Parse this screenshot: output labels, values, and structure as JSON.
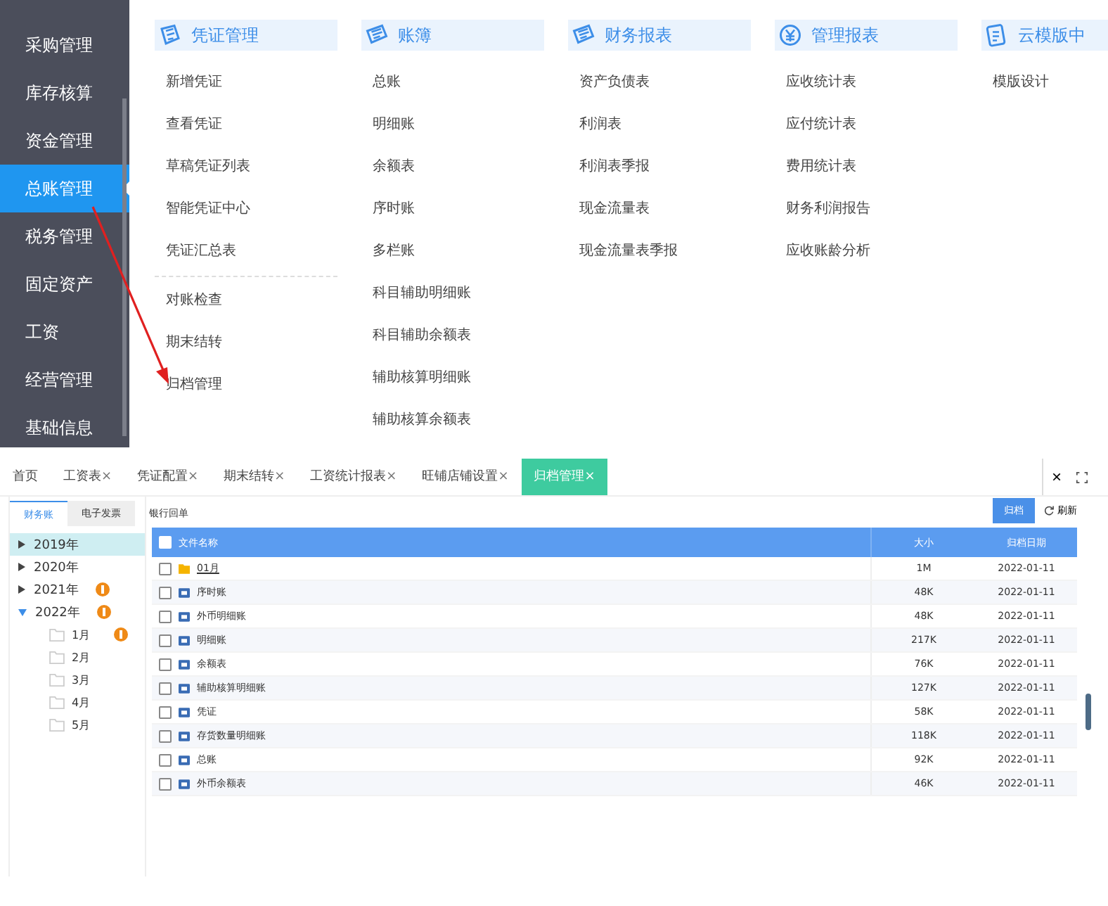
{
  "sidebar": {
    "items": [
      {
        "label": "采购管理",
        "selected": false
      },
      {
        "label": "库存核算",
        "selected": false
      },
      {
        "label": "资金管理",
        "selected": false
      },
      {
        "label": "总账管理",
        "selected": true
      },
      {
        "label": "税务管理",
        "selected": false
      },
      {
        "label": "固定资产",
        "selected": false
      },
      {
        "label": "工资",
        "selected": false
      },
      {
        "label": "经营管理",
        "selected": false
      },
      {
        "label": "基础信息",
        "selected": false
      }
    ]
  },
  "menu": {
    "columns": [
      {
        "title": "凭证管理",
        "kind": "voucher",
        "groups": [
          [
            "新增凭证",
            "查看凭证",
            "草稿凭证列表",
            "智能凭证中心",
            "凭证汇总表"
          ],
          [
            "对账检查",
            "期末结转",
            "归档管理"
          ]
        ]
      },
      {
        "title": "账簿",
        "kind": "books",
        "groups": [
          [
            "总账",
            "明细账",
            "余额表",
            "序时账",
            "多栏账",
            "科目辅助明细账",
            "科目辅助余额表",
            "辅助核算明细账",
            "辅助核算余额表"
          ]
        ]
      },
      {
        "title": "财务报表",
        "kind": "books",
        "groups": [
          [
            "资产负债表",
            "利润表",
            "利润表季报",
            "现金流量表",
            "现金流量表季报"
          ]
        ]
      },
      {
        "title": "管理报表",
        "kind": "money",
        "groups": [
          [
            "应收统计表",
            "应付统计表",
            "费用统计表",
            "财务利润报告",
            "应收账龄分析"
          ]
        ]
      },
      {
        "title": "云模版中",
        "kind": "cloud",
        "groups": [
          [
            "模版设计"
          ]
        ]
      }
    ]
  },
  "tabs": [
    {
      "label": "首页",
      "selected": false
    },
    {
      "label": "工资表",
      "close": "×",
      "selected": false
    },
    {
      "label": "凭证配置",
      "close": "×",
      "selected": false
    },
    {
      "label": "期末结转",
      "close": "×",
      "selected": false
    },
    {
      "label": "工资统计报表",
      "close": "×",
      "selected": false
    },
    {
      "label": "旺铺店铺设置",
      "close": "×",
      "selected": false
    },
    {
      "label": "归档管理",
      "close": "×",
      "selected": true
    }
  ],
  "tab_bar_controls": {
    "close": "×"
  },
  "subtabs": [
    {
      "label": "财务账",
      "selected": true
    },
    {
      "label": "电子发票",
      "selected": false
    },
    {
      "label": "银行回单",
      "selected": false
    }
  ],
  "archive_button": "归档",
  "refresh_button": "刷新",
  "tree": [
    {
      "label": "2019年",
      "expanded": false,
      "selected": true,
      "badge": false
    },
    {
      "label": "2020年",
      "expanded": false,
      "selected": false,
      "badge": false
    },
    {
      "label": "2021年",
      "expanded": false,
      "selected": false,
      "badge": true
    },
    {
      "label": "2022年",
      "expanded": true,
      "selected": false,
      "badge": true,
      "children": [
        {
          "label": "1月",
          "badge": true
        },
        {
          "label": "2月",
          "badge": false
        },
        {
          "label": "3月",
          "badge": false
        },
        {
          "label": "4月",
          "badge": false
        },
        {
          "label": "5月",
          "badge": false
        }
      ]
    }
  ],
  "table": {
    "columns": [
      "文件名称",
      "大小",
      "归档日期"
    ],
    "all_checked": false,
    "rows": [
      {
        "kind": "folder",
        "name": "01月",
        "size": "1M",
        "date": "2022-01-11",
        "checked": false
      },
      {
        "kind": "file",
        "name": "序时账",
        "size": "48K",
        "date": "2022-01-11",
        "checked": false
      },
      {
        "kind": "file",
        "name": "外币明细账",
        "size": "48K",
        "date": "2022-01-11",
        "checked": false
      },
      {
        "kind": "file",
        "name": "明细账",
        "size": "217K",
        "date": "2022-01-11",
        "checked": false
      },
      {
        "kind": "file",
        "name": "余额表",
        "size": "76K",
        "date": "2022-01-11",
        "checked": false
      },
      {
        "kind": "file",
        "name": "辅助核算明细账",
        "size": "127K",
        "date": "2022-01-11",
        "checked": false
      },
      {
        "kind": "file",
        "name": "凭证",
        "size": "58K",
        "date": "2022-01-11",
        "checked": false
      },
      {
        "kind": "file",
        "name": "存货数量明细账",
        "size": "118K",
        "date": "2022-01-11",
        "checked": false
      },
      {
        "kind": "file",
        "name": "总账",
        "size": "92K",
        "date": "2022-01-11",
        "checked": false
      },
      {
        "kind": "file",
        "name": "外币余额表",
        "size": "46K",
        "date": "2022-01-11",
        "checked": false
      }
    ]
  },
  "annotation_arrow": true
}
